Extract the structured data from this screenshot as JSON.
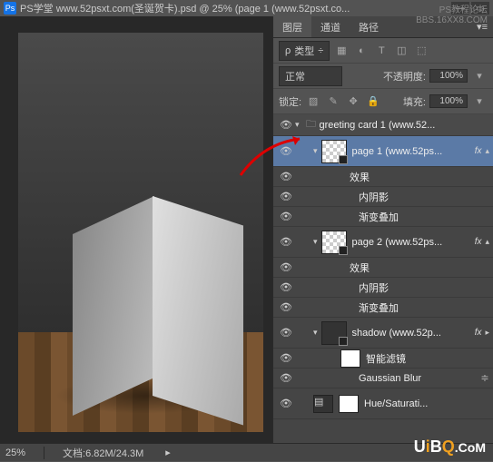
{
  "titlebar": {
    "logo_text": "Ps",
    "title": "PS学堂 www.52psxt.com(圣诞贺卡).psd @ 25% (page 1 (www.52psxt.co..."
  },
  "watermark": {
    "line1": "PS教程论坛",
    "line2": "BBS.16XX8.COM"
  },
  "panel": {
    "tabs": {
      "layers": "图层",
      "channels": "通道",
      "paths": "路径"
    },
    "filter_row": {
      "kind": "类型",
      "search": "ρ"
    },
    "blend_row": {
      "mode": "正常",
      "opacity_label": "不透明度:",
      "opacity_value": "100%"
    },
    "lock_row": {
      "lock_label": "锁定:",
      "fill_label": "填充:",
      "fill_value": "100%"
    },
    "layers": {
      "group1": "greeting card 1 (www.52...",
      "page1": "page 1 (www.52ps...",
      "effects": "效果",
      "inner_shadow": "内阴影",
      "grad_overlay": "渐变叠加",
      "page2": "page 2 (www.52ps...",
      "shadow": "shadow (www.52p...",
      "smart_filters": "智能滤镜",
      "gblur": "Gaussian Blur",
      "hue": "Hue/Saturati..."
    },
    "fx": "fx"
  },
  "statusbar": {
    "zoom": "25%",
    "doc": "文档:6.82M/24.3M"
  },
  "uibq": {
    "u": "U",
    "i": "i",
    "b": "B",
    "q": "Q",
    "com": ".CoM"
  }
}
